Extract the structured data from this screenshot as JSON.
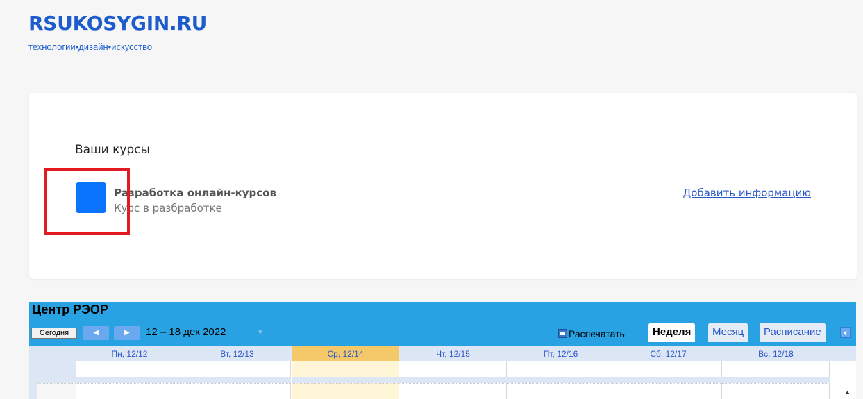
{
  "site": {
    "name": "RSUKOSYGIN.RU",
    "tagline": "технологии•дизайн•искусство"
  },
  "courses": {
    "heading": "Ваши курсы",
    "items": [
      {
        "title": "Разработка онлайн-курсов",
        "status": "Курс в разбработке",
        "action_label": "Добавить информацию",
        "icon_color": "#0a74ff"
      }
    ]
  },
  "calendar": {
    "title": "Центр РЭОР",
    "today_label": "Сегодня",
    "prev_icon": "chevron-left-icon",
    "next_icon": "chevron-right-icon",
    "date_range": "12 – 18 дек 2022",
    "print_label": "Распечатать",
    "tabs": [
      {
        "label": "Неделя",
        "active": true
      },
      {
        "label": "Месяц",
        "active": false
      },
      {
        "label": "Расписание",
        "active": false
      }
    ],
    "days": [
      {
        "label": "Пн, 12/12",
        "today": false
      },
      {
        "label": "Вт, 12/13",
        "today": false
      },
      {
        "label": "Ср, 12/14",
        "today": true
      },
      {
        "label": "Чт, 12/15",
        "today": false
      },
      {
        "label": "Пт, 12/16",
        "today": false
      },
      {
        "label": "Сб, 12/17",
        "today": false
      },
      {
        "label": "Вс, 12/18",
        "today": false
      }
    ]
  },
  "colors": {
    "brand": "#1d5ccc",
    "highlight_frame": "#e21b23",
    "calendar_bar": "#29a2e3",
    "today_column": "#f5c96a"
  }
}
